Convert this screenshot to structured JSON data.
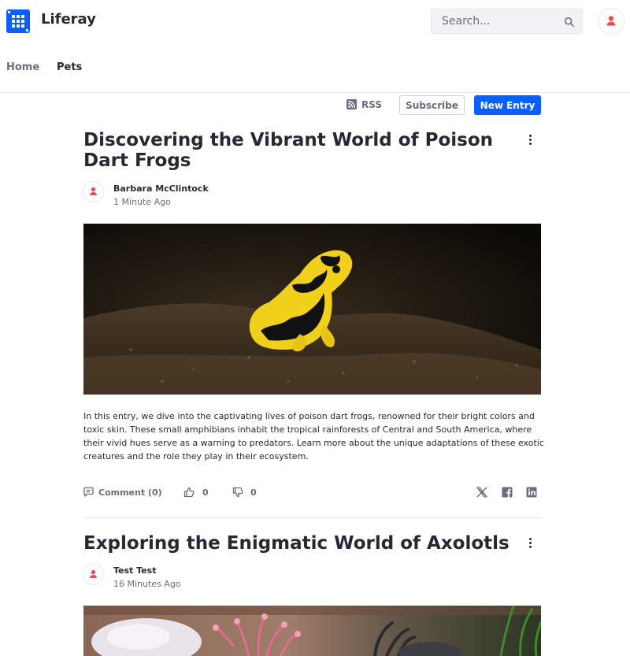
{
  "header": {
    "site_name": "Liferay",
    "search_placeholder": "Search...",
    "icons": {
      "logo": "liferay-logo",
      "search": "search-icon",
      "user": "user-icon"
    }
  },
  "nav": {
    "items": [
      "Home",
      "Pets"
    ],
    "active": "Pets"
  },
  "toolbar": {
    "rss_label": "RSS",
    "subscribe_label": "Subscribe",
    "new_entry_label": "New Entry"
  },
  "colors": {
    "primary": "#0b5fff",
    "avatar_icon": "#e84b4b",
    "text": "#272833",
    "secondary_text": "#6b6c7e"
  },
  "entries": [
    {
      "title": "Discovering the Vibrant World of Poison Dart Frogs",
      "author": "Barbara McClintock",
      "timestamp": "1 Minute Ago",
      "image_subject": "yellow-and-black poison dart frog on dark soil",
      "excerpt": "In this entry, we dive into the captivating lives of poison dart frogs, renowned for their bright colors and toxic skin. These small amphibians inhabit the tropical rainforests of Central and South America, where their vivid hues serve as a warning to predators. Learn more about the unique adaptations of these exotic creatures and the role they play in their ecosystem.",
      "comment_label": "Comment (0)",
      "likes": "0",
      "dislikes": "0",
      "share_icons": [
        "x-icon",
        "facebook-icon",
        "linkedin-icon"
      ]
    },
    {
      "title": "Exploring the Enigmatic World of Axolotls",
      "author": "Test Test",
      "timestamp": "16 Minutes Ago",
      "image_subject": "pink axolotls in an aquarium"
    }
  ]
}
